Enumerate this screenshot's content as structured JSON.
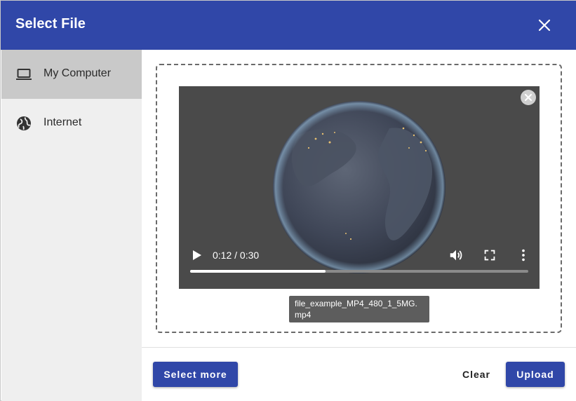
{
  "dialog": {
    "title": "Select File",
    "close_icon": "close-icon"
  },
  "sidebar": {
    "items": [
      {
        "label": "My Computer",
        "icon": "laptop-icon",
        "active": true
      },
      {
        "label": "Internet",
        "icon": "globe-icon",
        "active": false
      }
    ]
  },
  "preview": {
    "time": "0:12 / 0:30",
    "progress_fraction": 0.4,
    "filename": "file_example_MP4_480_1_5MG.mp4",
    "icons": {
      "remove": "remove-circle-icon",
      "play": "play-icon",
      "volume": "volume-icon",
      "fullscreen": "fullscreen-icon",
      "more": "more-vertical-icon"
    }
  },
  "footer": {
    "select_more_label": "Select more",
    "clear_label": "Clear",
    "upload_label": "Upload"
  },
  "colors": {
    "primary": "#3047a8",
    "sidebar_bg": "#efefef",
    "sidebar_active": "#c9c9c9",
    "video_bg": "#4a4a4a"
  }
}
